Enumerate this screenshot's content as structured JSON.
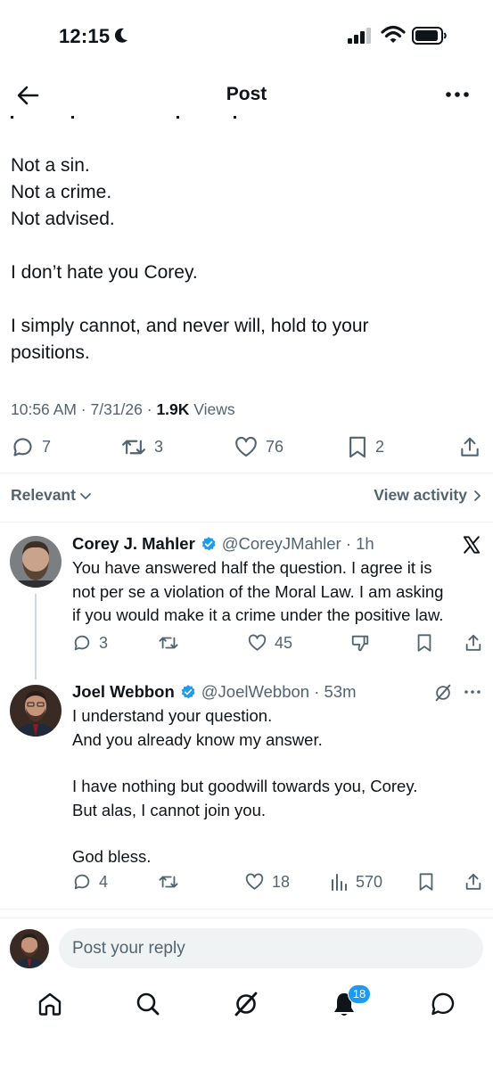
{
  "status_bar": {
    "time": "12:15"
  },
  "header": {
    "title": "Post"
  },
  "post": {
    "lines": [
      "Not a sin.",
      "Not a crime.",
      "Not advised.",
      "",
      "I don’t hate you Corey.",
      "",
      "I simply cannot, and never will, hold to your",
      "positions."
    ],
    "timestamp": "10:56 AM · 7/31/26 · ",
    "views_count": "1.9K",
    "views_label": " Views",
    "stats": {
      "replies": "7",
      "reposts": "3",
      "likes": "76",
      "bookmarks": "2"
    }
  },
  "filter": {
    "sort_label": "Relevant",
    "view_activity_label": "View activity"
  },
  "replies": [
    {
      "name": "Corey J. Mahler",
      "handle": "@CoreyJMahler · 1h",
      "body": [
        "You have answered half the question. I agree it is",
        "not per se a violation of the Moral Law. I am asking",
        "if you would make it a crime under the positive law."
      ],
      "stats": {
        "replies": "3",
        "reposts": "",
        "likes": "45"
      }
    },
    {
      "name": "Joel Webbon",
      "handle": "@JoelWebbon · 53m",
      "body": [
        "I understand your question.",
        "And you already know my answer.",
        "",
        "I have nothing but goodwill towards you, Corey.",
        "But alas, I cannot join you.",
        "",
        "God bless."
      ],
      "stats": {
        "replies": "4",
        "reposts": "",
        "likes": "18",
        "views": "570"
      }
    }
  ],
  "composer": {
    "placeholder": "Post your reply"
  },
  "nav": {
    "notifications_badge": "18"
  },
  "colors": {
    "accent": "#1d9bf0",
    "secondary_text": "#536471",
    "divider": "#eff3f4"
  }
}
